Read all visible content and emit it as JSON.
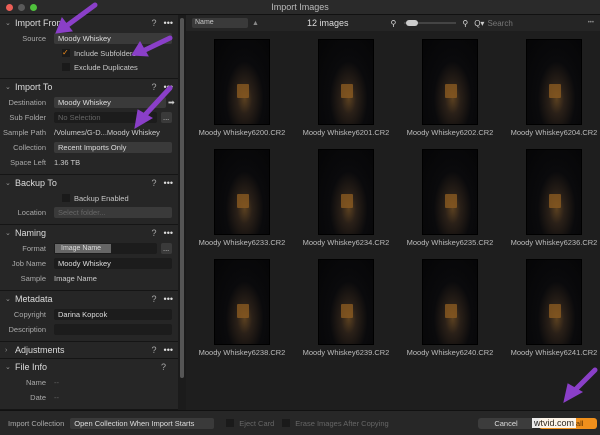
{
  "window": {
    "title": "Import Images",
    "close_color": "#ec5f57",
    "min_color": "#5a5a5a",
    "max_color": "#4fc13c"
  },
  "import_from": {
    "title": "Import From",
    "source_label": "Source",
    "source_value": "Moody Whiskey",
    "include_subfolders": "Include Subfolders",
    "include_subfolders_checked": true,
    "exclude_duplicates": "Exclude Duplicates",
    "exclude_duplicates_checked": false
  },
  "import_to": {
    "title": "Import To",
    "destination_label": "Destination",
    "destination_value": "Moody Whiskey",
    "subfolder_label": "Sub Folder",
    "subfolder_placeholder": "No Selection",
    "sample_path_label": "Sample Path",
    "sample_path_value": "/Volumes/G-D...Moody Whiskey",
    "collection_label": "Collection",
    "collection_value": "Recent Imports Only",
    "space_left_label": "Space Left",
    "space_left_value": "1.36 TB"
  },
  "backup_to": {
    "title": "Backup To",
    "backup_enabled": "Backup Enabled",
    "location_label": "Location",
    "location_placeholder": "Select folder..."
  },
  "naming": {
    "title": "Naming",
    "format_label": "Format",
    "format_token": "Image Name",
    "job_name_label": "Job Name",
    "job_name_value": "Moody Whiskey",
    "sample_label": "Sample",
    "sample_value": "Image Name"
  },
  "metadata": {
    "title": "Metadata",
    "copyright_label": "Copyright",
    "copyright_value": "Darina Kopcok",
    "description_label": "Description",
    "description_value": ""
  },
  "adjustments": {
    "title": "Adjustments"
  },
  "file_info": {
    "title": "File Info",
    "name_label": "Name",
    "name_value": "--",
    "date_label": "Date",
    "date_value": "--"
  },
  "common": {
    "help": "?",
    "more": "•••",
    "browse": "..."
  },
  "toolbar": {
    "sort_value": "Name",
    "count": "12 images",
    "search_placeholder": "Search"
  },
  "images": [
    "Moody Whiskey6200.CR2",
    "Moody Whiskey6201.CR2",
    "Moody Whiskey6202.CR2",
    "Moody Whiskey6204.CR2",
    "Moody Whiskey6233.CR2",
    "Moody Whiskey6234.CR2",
    "Moody Whiskey6235.CR2",
    "Moody Whiskey6236.CR2",
    "Moody Whiskey6238.CR2",
    "Moody Whiskey6239.CR2",
    "Moody Whiskey6240.CR2",
    "Moody Whiskey6241.CR2"
  ],
  "bottom": {
    "import_collection_label": "Import Collection",
    "import_collection_value": "Open Collection When Import Starts",
    "eject_card": "Eject Card",
    "erase_images": "Erase Images After Copying",
    "cancel": "Cancel",
    "import_all": "Import all",
    "accent": "#f0901c"
  },
  "watermark": "wtvid.com",
  "annotation_color": "#8a3fc8"
}
